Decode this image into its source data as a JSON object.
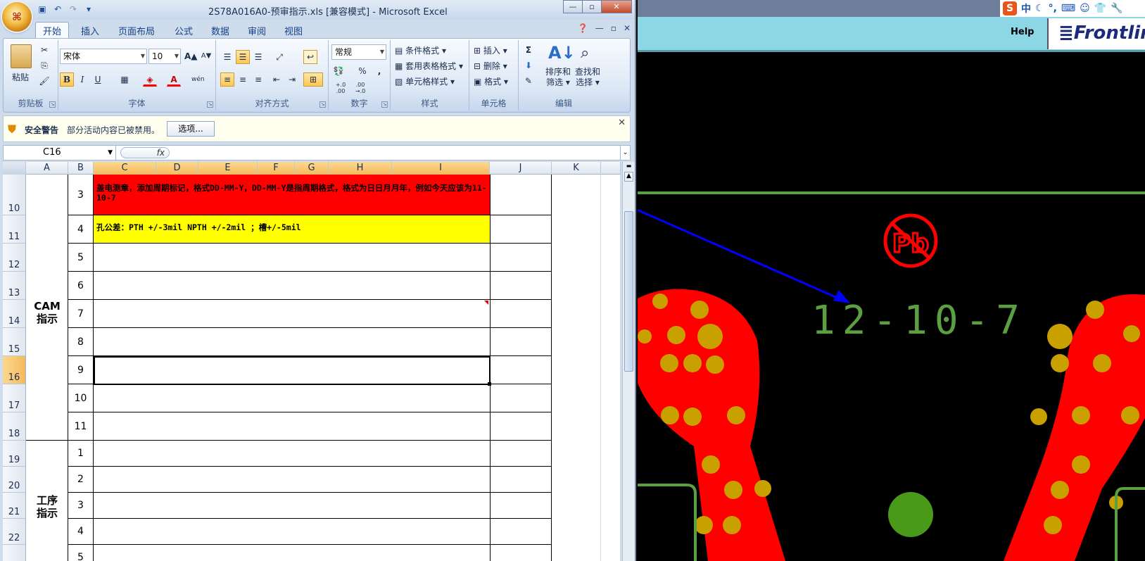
{
  "excel": {
    "title": "2S78A016A0-预审指示.xls  [兼容模式] - Microsoft Excel",
    "office_button_glyph": "⌘",
    "window_controls": {
      "min": "—",
      "max": "▫",
      "close": "✕"
    },
    "tabs": [
      "开始",
      "插入",
      "页面布局",
      "公式",
      "数据",
      "审阅",
      "视图"
    ],
    "active_tab": "开始",
    "ribbon": {
      "clipboard": {
        "label": "剪贴板",
        "paste": "粘贴"
      },
      "font": {
        "label": "字体",
        "font_name": "宋体",
        "font_size": "10",
        "bold": "B",
        "italic": "I",
        "underline": "U",
        "grow": "A▲",
        "shrink": "A▼",
        "pinyin": "wén"
      },
      "alignment": {
        "label": "对齐方式"
      },
      "number": {
        "label": "数字",
        "format": "常规",
        "percent": "%",
        "comma": ",",
        "inc_dec": "+.0 .00",
        "dec_dec": ".00 →.0"
      },
      "styles": {
        "label": "样式",
        "conditional": "条件格式",
        "table": "套用表格格式",
        "cell_styles": "单元格样式"
      },
      "cells": {
        "label": "单元格",
        "insert": "插入",
        "delete": "删除",
        "format": "格式"
      },
      "editing": {
        "label": "编辑",
        "sigma": "Σ",
        "sort": "排序和\n筛选",
        "sort_line1": "排序和",
        "sort_line2": "筛选",
        "find_line1": "查找和",
        "find_line2": "选择"
      }
    },
    "security": {
      "title": "安全警告",
      "message": "部分活动内容已被禁用。",
      "options_button": "选项..."
    },
    "name_box": "C16",
    "fx": "fx",
    "columns": [
      "A",
      "B",
      "C",
      "D",
      "E",
      "F",
      "G",
      "H",
      "I",
      "J",
      "K"
    ],
    "row_headers": [
      "10",
      "11",
      "12",
      "13",
      "14",
      "15",
      "16",
      "17",
      "18",
      "19",
      "20",
      "21",
      "22"
    ],
    "sections": [
      {
        "label_line1": "CAM",
        "label_line2": "指示"
      },
      {
        "label_line1": "工序",
        "label_line2": "指示"
      }
    ],
    "rows": [
      {
        "num": "3",
        "text": "盖电测章，添加周期标记，格式DD-MM-Y，DD-MM-Y是指周期格式，格式为日日月月年，例如今天应该为11-10-7",
        "fill": "#ff0000"
      },
      {
        "num": "4",
        "text": "孔公差：PTH +/-3mil NPTH +/-2mil ；槽+/-5mil",
        "fill": "#ffff00"
      },
      {
        "num": "5",
        "text": ""
      },
      {
        "num": "6",
        "text": ""
      },
      {
        "num": "7",
        "text": ""
      },
      {
        "num": "8",
        "text": ""
      },
      {
        "num": "9",
        "text": ""
      },
      {
        "num": "10",
        "text": ""
      },
      {
        "num": "11",
        "text": ""
      },
      {
        "num": "1",
        "text": ""
      },
      {
        "num": "2",
        "text": ""
      },
      {
        "num": "3",
        "text": ""
      },
      {
        "num": "4",
        "text": ""
      },
      {
        "num": "5",
        "text": ""
      }
    ]
  },
  "cam": {
    "help": "Help",
    "logo": "≣Frontlin",
    "tray": {
      "ime": "中",
      "s_logo": "S"
    },
    "marking_text": "12-10-7",
    "pb_text": "Pb",
    "colors": {
      "pad": "#ff0000",
      "via": "#c8a000",
      "silk": "#4a9a1a",
      "trace": "#5aa040",
      "arrow": "#0000ff"
    }
  }
}
